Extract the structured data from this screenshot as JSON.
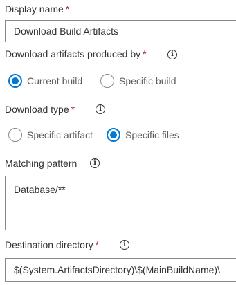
{
  "display_name": {
    "label": "Display name",
    "required": "*",
    "value": "Download Build Artifacts"
  },
  "download_artifacts": {
    "label": "Download artifacts produced by",
    "required": "*",
    "info_icon": "info-icon",
    "options": [
      {
        "label": "Current build",
        "checked": true
      },
      {
        "label": "Specific build",
        "checked": false
      }
    ]
  },
  "download_type": {
    "label": "Download type",
    "required": "*",
    "info_icon": "info-icon",
    "options": [
      {
        "label": "Specific artifact",
        "checked": false
      },
      {
        "label": "Specific files",
        "checked": true
      }
    ]
  },
  "matching_pattern": {
    "label": "Matching pattern",
    "info_icon": "info-icon",
    "value": "Database/**"
  },
  "destination_directory": {
    "label": "Destination directory",
    "required": "*",
    "info_icon": "info-icon",
    "value": "$(System.ArtifactsDirectory)\\$(MainBuildName)\\"
  },
  "colors": {
    "accent": "#0078d4",
    "required": "#a4262c",
    "border": "#8a8886"
  }
}
